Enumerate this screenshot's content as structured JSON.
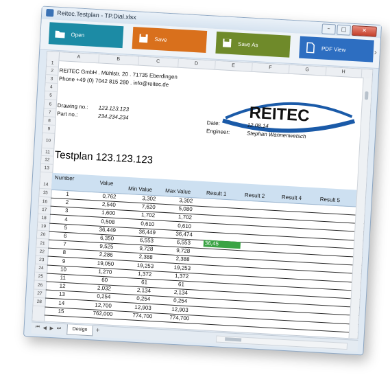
{
  "window": {
    "title": "Reitec.Testplan - TP.Dial.xlsx"
  },
  "toolbar": {
    "open_label": "Open",
    "save_label": "Save",
    "save_as_label": "Save As",
    "pdf_label": "PDF View",
    "more_glyph": "›"
  },
  "columns": [
    "A",
    "B",
    "C",
    "D",
    "E",
    "F",
    "G",
    "H"
  ],
  "rows": [
    "1",
    "2",
    "3",
    "4",
    "5",
    "6",
    "7",
    "8",
    "9",
    "10",
    "11",
    "12",
    "13",
    "14",
    "15",
    "16",
    "17",
    "18",
    "19",
    "20",
    "21",
    "22",
    "23",
    "24",
    "25",
    "26",
    "27",
    "28"
  ],
  "header_info": {
    "company_line": "REITEC GmbH . Mühlstr. 20 . 71735 Eberdingen",
    "phone_line": "Phone +49 (0) 7042 815 280 . info@reitec.de",
    "drawing_label": "Drawing no.:",
    "drawing_value": "123.123.123",
    "part_label": "Part no.:",
    "part_value": "234.234.234",
    "date_label": "Date:",
    "date_value": "12.08.14",
    "engineer_label": "Engineer:",
    "engineer_value": "Stephan Wannenwetsch",
    "logo_text": "REITEC"
  },
  "heading": "Testplan 123.123.123",
  "table": {
    "headers": [
      "Number",
      "Value",
      "Min Value",
      "Max Value",
      "Result 1",
      "Result 2",
      "Result 4",
      "Result 5"
    ],
    "rows": [
      [
        "1",
        "0,762",
        "3,302",
        "3,302"
      ],
      [
        "2",
        "2,540",
        "7,620",
        "5,080"
      ],
      [
        "3",
        "1,600",
        "1,702",
        "1,702"
      ],
      [
        "4",
        "0,508",
        "0,610",
        "0,610"
      ],
      [
        "5",
        "36,449",
        "36,449",
        "36,474"
      ],
      [
        "6",
        "6,350",
        "6,553",
        "6,553"
      ],
      [
        "7",
        "9,525",
        "9,728",
        "9,728"
      ],
      [
        "8",
        "2,286",
        "2,388",
        "2,388"
      ],
      [
        "9",
        "19,050",
        "19,253",
        "19,253"
      ],
      [
        "10",
        "1,270",
        "1,372",
        "1,372"
      ],
      [
        "11",
        "60",
        "61",
        "61"
      ],
      [
        "12",
        "2,032",
        "2,134",
        "2,134"
      ],
      [
        "13",
        "0,254",
        "0,254",
        "0,254"
      ],
      [
        "14",
        "12,700",
        "12,903",
        "12,903"
      ],
      [
        "15",
        "762,000",
        "774,700",
        "774,700"
      ]
    ],
    "result1_row6": "36,45"
  },
  "sheet_tabs": {
    "active": "Design",
    "add": "+"
  },
  "colors": {
    "open": "#1c8ba5",
    "save": "#d9701c",
    "save_as": "#6f8a2a",
    "pdf": "#2d6ec1",
    "pass": "#3aa344",
    "logo": "#1a5aa8"
  }
}
